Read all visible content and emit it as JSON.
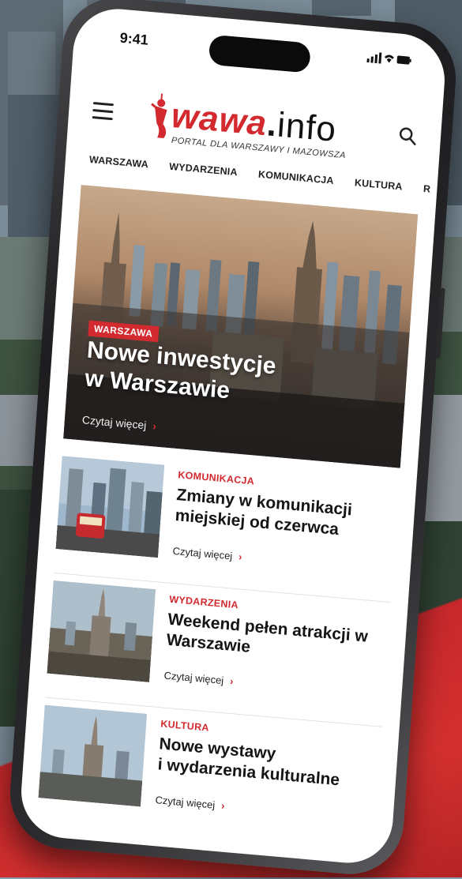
{
  "status": {
    "time": "9:41",
    "icons": "▂▄▆ ≋ ▭"
  },
  "header": {
    "logo": {
      "brand": "wawa",
      "dot": ".",
      "suffix": "info",
      "tagline": "PORTAL DLA WARSZAWY I MAZOWSZA"
    }
  },
  "nav": {
    "items": [
      "WARSZAWA",
      "WYDARZENIA",
      "KOMUNIKACJA",
      "KULTURA",
      "R"
    ]
  },
  "hero": {
    "category": "WARSZAWA",
    "title_line1": "Nowe inwestycje",
    "title_line2": "w Warszawie",
    "link": "Czytaj więcej"
  },
  "articles": [
    {
      "category": "KOMUNIKACJA",
      "title": "Zmiany w komunikacji miejskiej od czerwca",
      "link": "Czytaj więcej"
    },
    {
      "category": "WYDARZENIA",
      "title": "Weekend pełen atrakcji w Warszawie",
      "link": "Czytaj więcej"
    },
    {
      "category": "KULTURA",
      "title_line1": "Nowe wystawy",
      "title_line2": "i wydarzenia kulturalne",
      "link": "Czytaj więcej"
    }
  ],
  "icons": {
    "menu": "hamburger-icon",
    "search": "search-icon",
    "chevron": "chevron-right-icon"
  },
  "colors": {
    "brand_red": "#d22a2f",
    "text_dark": "#151515"
  }
}
